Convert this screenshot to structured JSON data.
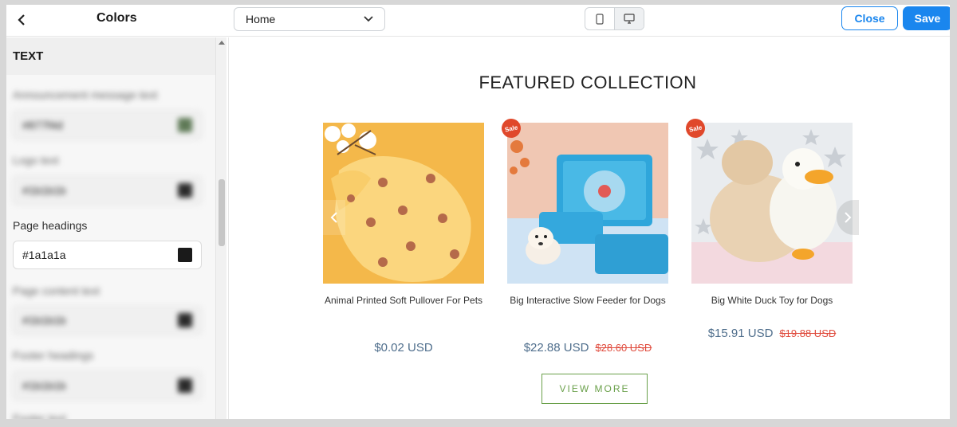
{
  "header": {
    "back_icon": "chevron-left-icon",
    "panel_title": "Colors",
    "page_select": {
      "value": "Home"
    },
    "device_toggle": {
      "mobile_icon": "mobile-icon",
      "desktop_icon": "desktop-icon",
      "active": "desktop"
    },
    "close_label": "Close",
    "save_label": "Save",
    "accent_color": "#1a86ee"
  },
  "sidebar": {
    "section_title": "TEXT",
    "fields": [
      {
        "label": "Announcement message text",
        "value": "#877f4d",
        "swatch": "#5f7a57",
        "blurred": true
      },
      {
        "label": "Logo text",
        "value": "#1b1b1b",
        "swatch": "#2a2a2a",
        "blurred": true
      },
      {
        "label": "Page headings",
        "value": "#1a1a1a",
        "swatch": "#1a1a1a",
        "blurred": false
      },
      {
        "label": "Page content text",
        "value": "#1b1b1b",
        "swatch": "#2a2a2a",
        "blurred": true
      },
      {
        "label": "Footer headings",
        "value": "#1b1b1b",
        "swatch": "#2a2a2a",
        "blurred": true
      },
      {
        "label": "Footer text",
        "value": "",
        "swatch": "",
        "blurred": true
      }
    ]
  },
  "preview": {
    "section_title": "FEATURED COLLECTION",
    "products": [
      {
        "name": "Animal Printed Soft Pullover For Pets",
        "price": "$0.02 USD",
        "compare_price": "",
        "sale": false
      },
      {
        "name": "Big Interactive Slow Feeder for Dogs",
        "price": "$22.88 USD",
        "compare_price": "$28.60 USD",
        "sale": true
      },
      {
        "name": "Big White Duck Toy for Dogs",
        "price": "$15.91 USD",
        "compare_price": "$19.88 USD",
        "sale": true
      }
    ],
    "sale_badge_label": "Sale",
    "view_more_label": "VIEW MORE",
    "price_color": "#4f6e8c",
    "compare_price_color": "#e04c3e",
    "button_color": "#6aa04a"
  }
}
